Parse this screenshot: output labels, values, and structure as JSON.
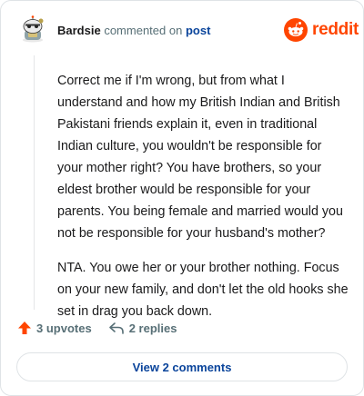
{
  "header": {
    "username": "Bardsie",
    "action_text": "commented on",
    "post_link": "post",
    "logo_text": "reddit",
    "brand_color": "#ff4500",
    "link_color": "#0a449b"
  },
  "comment": {
    "paragraphs": [
      "Correct me if I'm wrong, but from what I understand and how my British Indian and British Pakistani friends explain it, even in traditional Indian culture, you wouldn't be responsible for your mother right? You have brothers, so your eldest brother would be responsible for your parents. You being female and married would you not be responsible for your husband's mother?",
      "NTA. You owe her or your brother nothing. Focus on your new family, and don't let the old hooks she set in drag you back down."
    ]
  },
  "actions": {
    "upvotes_label": "3 upvotes",
    "replies_label": "2 replies",
    "upvote_icon": "upvote-arrow-icon",
    "reply_icon": "reply-arrow-icon"
  },
  "footer": {
    "view_comments_label": "View 2 comments"
  }
}
